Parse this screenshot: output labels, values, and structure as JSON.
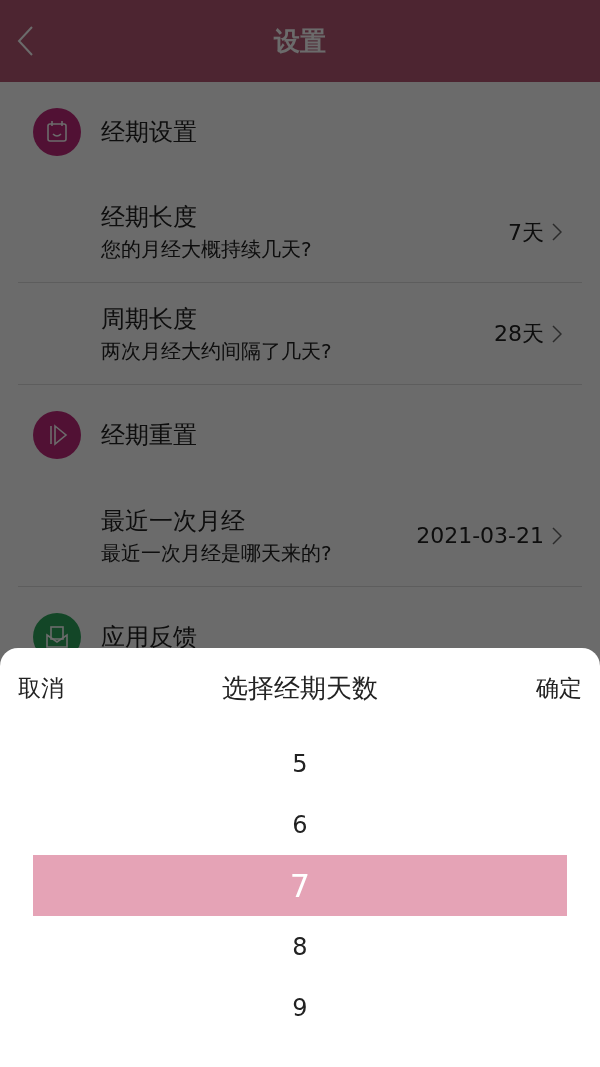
{
  "header": {
    "title": "设置"
  },
  "sections": [
    {
      "title": "经期设置",
      "kind": "calendar",
      "items": [
        {
          "title": "经期长度",
          "subtitle": "您的月经大概持续几天?",
          "value": "7天"
        },
        {
          "title": "周期长度",
          "subtitle": "两次月经大约间隔了几天?",
          "value": "28天"
        }
      ]
    },
    {
      "title": "经期重置",
      "kind": "play",
      "items": [
        {
          "title": "最近一次月经",
          "subtitle": "最近一次月经是哪天来的?",
          "value": "2021-03-21"
        }
      ]
    },
    {
      "title": "应用反馈",
      "kind": "mail"
    }
  ],
  "picker": {
    "cancel": "取消",
    "title": "选择经期天数",
    "confirm": "确定",
    "options": [
      {
        "label": "5",
        "selected": false
      },
      {
        "label": "6",
        "selected": false
      },
      {
        "label": "7",
        "selected": true
      },
      {
        "label": "8",
        "selected": false
      },
      {
        "label": "9",
        "selected": false
      }
    ]
  }
}
